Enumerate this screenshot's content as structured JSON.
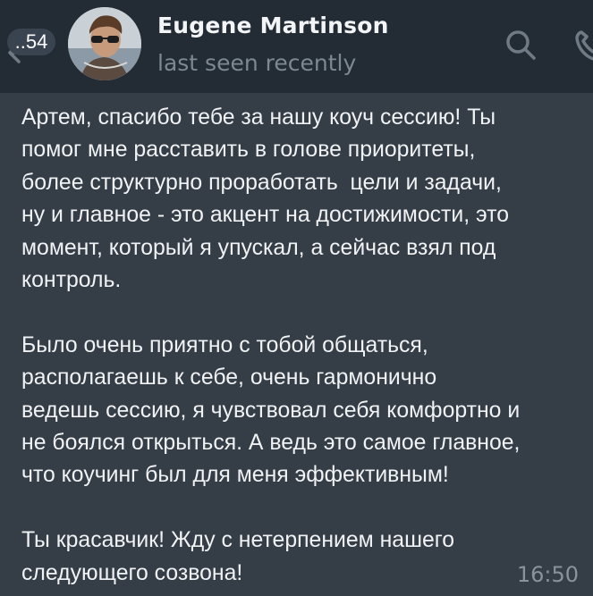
{
  "header": {
    "unread_count": "..54",
    "contact_name": "Eugene Martinson",
    "status": "last seen recently",
    "icons": [
      "back-arrow-icon",
      "search-icon",
      "phone-icon"
    ]
  },
  "message": {
    "text": "Артем, спасибо тебе за нашу коуч сессию! Ты\nпомог мне расставить в голове приоритеты,\nболее структурно проработать  цели и задачи,\nну и главное - это акцент на достижимости, это\nмомент, который я упускал, а сейчас взял под\nконтроль.\n\nБыло очень приятно с тобой общаться,\nрасполагаешь к себе, очень гармонично\nведешь сессию, я чувствовал себя комфортно и\nне боялся открыться. А ведь это самое главное,\nчто коучинг был для меня эффективным!\n\nТы красавчик! Жду с нетерпением нашего\nследующего созвона!",
    "time": "16:50"
  },
  "colors": {
    "header_bg": "#232c35",
    "bubble_bg": "#353d47",
    "text": "#f0f2f4",
    "muted": "#7d8893"
  }
}
